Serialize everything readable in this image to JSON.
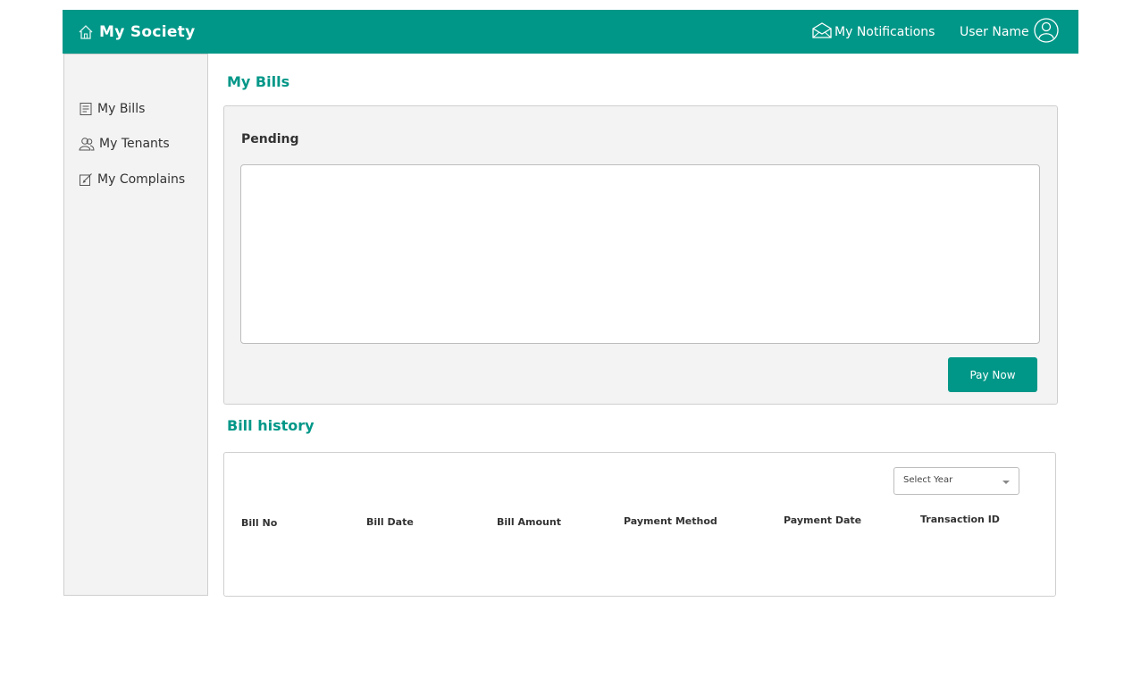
{
  "header": {
    "brand": "My Society",
    "brand_icon": "home-icon",
    "notifications": "My Notifications",
    "notifications_icon": "envelope-icon",
    "user_name": "User Name",
    "user_icon": "user-avatar-icon"
  },
  "sidebar": {
    "items": [
      {
        "label": "My Bills",
        "icon": "bill-icon"
      },
      {
        "label": "My Tenants",
        "icon": "tenants-icon"
      },
      {
        "label": "My Complains",
        "icon": "edit-icon"
      }
    ]
  },
  "main": {
    "title": "My Bills",
    "pending": {
      "label": "Pending",
      "pay_button": "Pay Now"
    },
    "history": {
      "title": "Bill history",
      "year_select": "Select Year",
      "columns": [
        "Bill No",
        "Bill Date",
        "Bill Amount",
        "Payment Method",
        "Payment Date",
        "Transaction ID"
      ]
    }
  },
  "colors": {
    "accent": "#019788",
    "panel_bg": "#f3f3f3"
  }
}
